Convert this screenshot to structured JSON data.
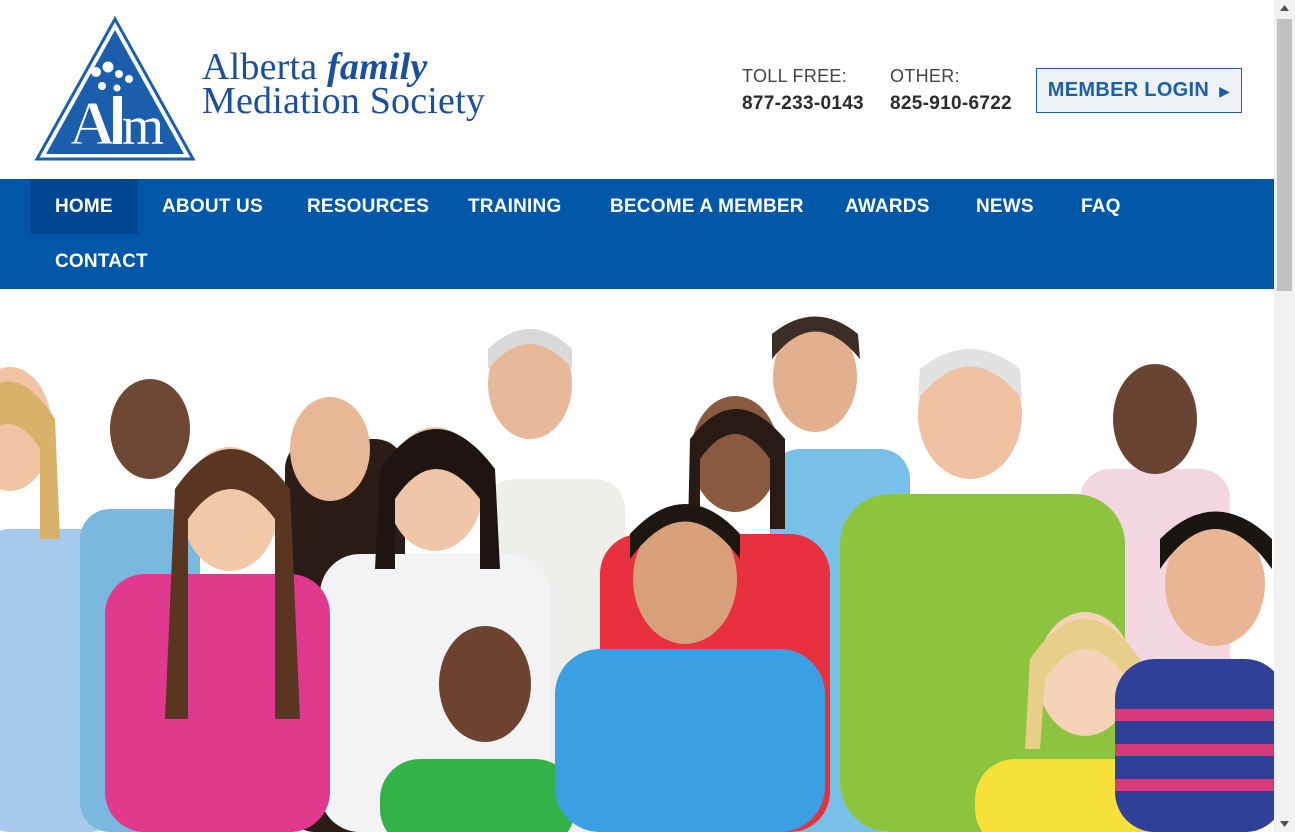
{
  "brand": {
    "logo_mark_text": "AFM",
    "name_line1_prefix": "Alberta ",
    "name_line1_emphasis": "family",
    "name_line2": "Mediation Society",
    "color": "#1b4f9c"
  },
  "contact": {
    "toll_free_label": "TOLL FREE:",
    "toll_free_number": "877-233-0143",
    "other_label": "OTHER:",
    "other_number": "825-910-6722"
  },
  "login": {
    "label": "MEMBER LOGIN",
    "icon": "play-arrow-icon"
  },
  "nav": {
    "items": [
      {
        "label": "HOME",
        "active": true
      },
      {
        "label": "ABOUT US"
      },
      {
        "label": "RESOURCES"
      },
      {
        "label": "TRAINING"
      },
      {
        "label": "BECOME A MEMBER"
      },
      {
        "label": "AWARDS"
      },
      {
        "label": "NEWS"
      },
      {
        "label": "FAQ"
      },
      {
        "label": "CONTACT"
      }
    ],
    "background": "#0057a8",
    "active_background": "#004691"
  },
  "hero": {
    "description": "group-photo-diverse-families"
  }
}
